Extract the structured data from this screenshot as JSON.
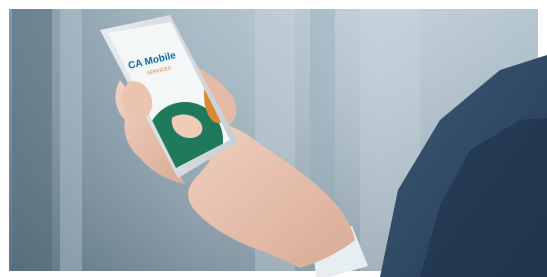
{
  "photo": {
    "app_splash": {
      "brand_line1": "CA Mobile",
      "brand_line2": "SERVICES",
      "colors": {
        "brand_blue": "#0e6fa8",
        "brand_orange": "#e07b2a",
        "screen_green": "#1f7a5c",
        "screen_orange": "#d98a33",
        "screen_white": "#f4f7f8"
      }
    }
  }
}
